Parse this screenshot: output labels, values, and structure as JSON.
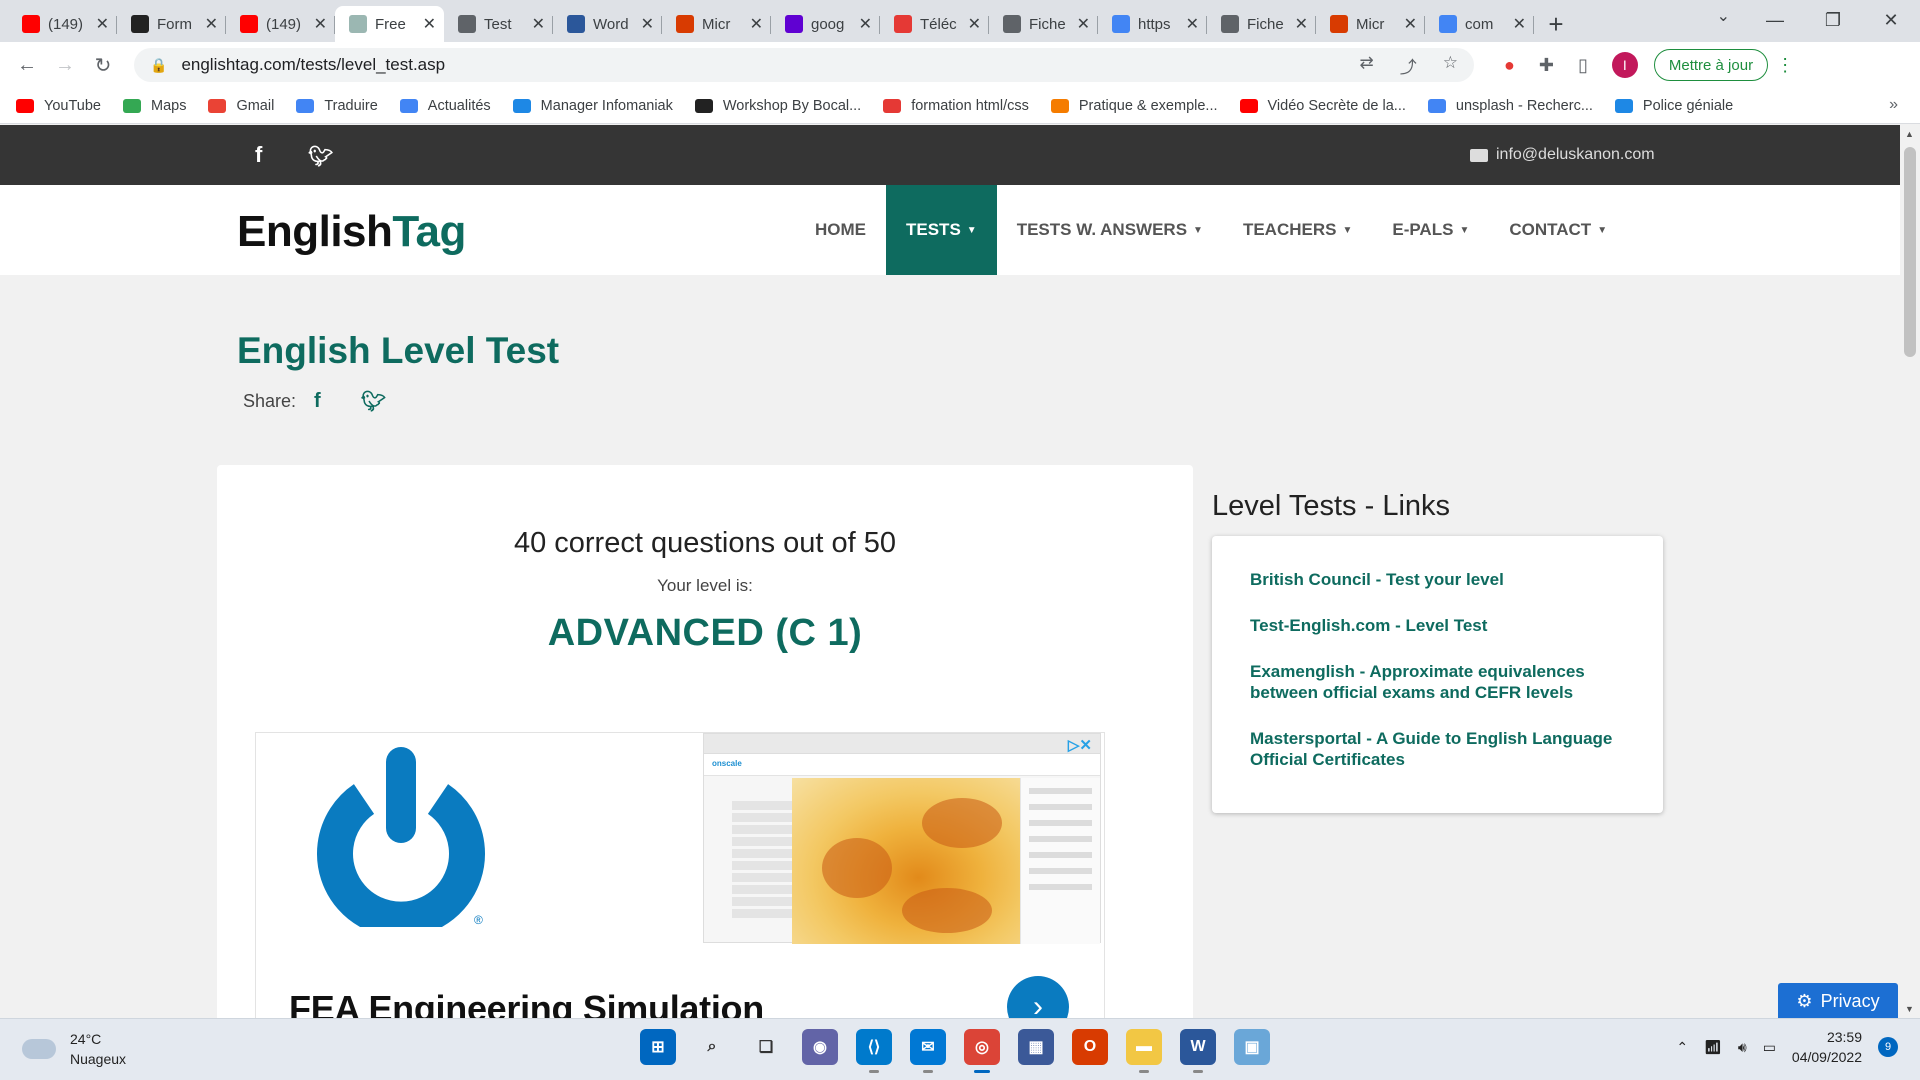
{
  "browser": {
    "tabs": [
      {
        "title": "(149)",
        "icon": "youtube-icon",
        "color": "#ff0000",
        "active": false
      },
      {
        "title": "Form",
        "icon": "formation-icon",
        "color": "#222222",
        "active": false
      },
      {
        "title": "(149)",
        "icon": "youtube-icon",
        "color": "#ff0000",
        "active": false
      },
      {
        "title": "Free",
        "icon": "englishtag-icon",
        "color": "#9bb7b2",
        "active": true
      },
      {
        "title": "Test",
        "icon": "globe-icon",
        "color": "#5f6368",
        "active": false
      },
      {
        "title": "Word",
        "icon": "word-icon",
        "color": "#2b579a",
        "active": false
      },
      {
        "title": "Micr",
        "icon": "office-icon",
        "color": "#d83b01",
        "active": false
      },
      {
        "title": "goog",
        "icon": "yahoo-icon",
        "color": "#6001d2",
        "active": false
      },
      {
        "title": "Téléc",
        "icon": "download-icon",
        "color": "#e53935",
        "active": false
      },
      {
        "title": "Fiche",
        "icon": "globe-icon",
        "color": "#5f6368",
        "active": false
      },
      {
        "title": "https",
        "icon": "google-icon",
        "color": "#4285f4",
        "active": false
      },
      {
        "title": "Fiche",
        "icon": "globe-icon",
        "color": "#5f6368",
        "active": false
      },
      {
        "title": "Micr",
        "icon": "office-icon",
        "color": "#d83b01",
        "active": false
      },
      {
        "title": "com",
        "icon": "google-icon",
        "color": "#4285f4",
        "active": false
      }
    ],
    "url": "englishtag.com/tests/level_test.asp",
    "update_button": "Mettre à jour",
    "avatar_letter": "I",
    "bookmarks": [
      {
        "label": "YouTube",
        "color": "#ff0000"
      },
      {
        "label": "Maps",
        "color": "#34a853"
      },
      {
        "label": "Gmail",
        "color": "#ea4335"
      },
      {
        "label": "Traduire",
        "color": "#4285f4"
      },
      {
        "label": "Actualités",
        "color": "#4285f4"
      },
      {
        "label": "Manager Infomaniak",
        "color": "#1e88e5"
      },
      {
        "label": "Workshop By Bocal...",
        "color": "#222222"
      },
      {
        "label": "formation html/css",
        "color": "#e53935"
      },
      {
        "label": "Pratique & exemple...",
        "color": "#f57c00"
      },
      {
        "label": "Vidéo Secrète de la...",
        "color": "#ff0000"
      },
      {
        "label": "unsplash - Recherc...",
        "color": "#4285f4"
      },
      {
        "label": "Police géniale",
        "color": "#1e88e5"
      }
    ]
  },
  "site": {
    "email": "info@deluskanon.com",
    "logo_part1": "English",
    "logo_part2": "Tag",
    "menu": [
      {
        "label": "HOME",
        "dropdown": false,
        "active": false
      },
      {
        "label": "TESTS",
        "dropdown": true,
        "active": true
      },
      {
        "label": "TESTS W. ANSWERS",
        "dropdown": true,
        "active": false
      },
      {
        "label": "TEACHERS",
        "dropdown": true,
        "active": false
      },
      {
        "label": "E-PALS",
        "dropdown": true,
        "active": false
      },
      {
        "label": "CONTACT",
        "dropdown": true,
        "active": false
      }
    ],
    "page_title": "English Level Test",
    "share_label": "Share:",
    "result": {
      "score_text": "40 correct questions out of 50",
      "level_label": "Your level is:",
      "level": "ADVANCED (C 1)"
    },
    "ad": {
      "title": "FEA Engineering Simulation",
      "shot_brand": "onscale"
    },
    "sidebar": {
      "title": "Level Tests - Links",
      "links": [
        "British Council - Test your level",
        "Test-English.com - Level Test",
        "Examenglish - Approximate equivalences between official exams and CEFR levels",
        "Mastersportal - A Guide to English Language Official Certificates"
      ]
    },
    "privacy_label": "Privacy",
    "accent_color": "#0e6b5f"
  },
  "taskbar": {
    "temperature": "24°C",
    "condition": "Nuageux",
    "time": "23:59",
    "date": "04/09/2022",
    "notifications": "9",
    "apps": [
      {
        "name": "windows-start-icon",
        "color": "#0067c0"
      },
      {
        "name": "search-icon",
        "color": "#333333"
      },
      {
        "name": "task-view-icon",
        "color": "#333333"
      },
      {
        "name": "teams-chat-icon",
        "color": "#6264a7"
      },
      {
        "name": "vscode-icon",
        "color": "#007acc"
      },
      {
        "name": "mail-icon",
        "color": "#0078d4"
      },
      {
        "name": "chrome-icon",
        "color": "#db4437"
      },
      {
        "name": "store-icon",
        "color": "#3b5998"
      },
      {
        "name": "office-icon",
        "color": "#d83b01"
      },
      {
        "name": "file-explorer-icon",
        "color": "#f2c744"
      },
      {
        "name": "word-icon",
        "color": "#2b579a"
      },
      {
        "name": "image-viewer-icon",
        "color": "#6aa7d8"
      }
    ]
  }
}
